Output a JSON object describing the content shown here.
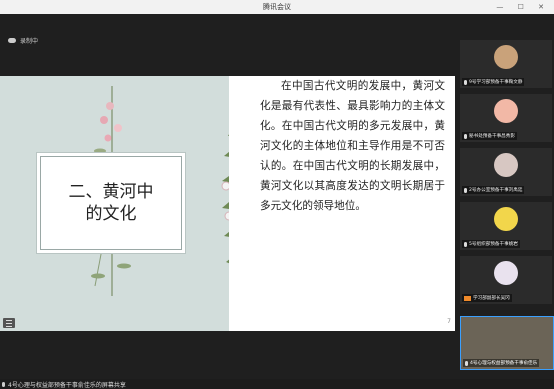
{
  "window": {
    "title": "腾讯会议"
  },
  "recording": {
    "label": "录制中"
  },
  "slide": {
    "title": "二、黄河中\n的文化",
    "body": "在中国古代文明的发展中，黄河文化是最有代表性、最具影响力的主体文化。在中国古代文明的多元发展中，黄河文化的主体地位和主导作用是不可否认的。在中国古代文明的长期发展中，黄河文化以其高度发达的文明长期居于多元文化的领导地位。",
    "page_number": "7"
  },
  "participants": [
    {
      "name": "9号学习部预备干事鞠文静",
      "avatar": "animal"
    },
    {
      "name": "秘书处预备干事昌秀影",
      "avatar": "pig"
    },
    {
      "name": "2号办公室预备干事刘禹廷",
      "avatar": "girl"
    },
    {
      "name": "5号组织部预备干事姚岩",
      "avatar": "cartoon"
    },
    {
      "name": "学习部副部长吴冈",
      "avatar": "anime"
    }
  ],
  "active_video": {
    "name": "4号心理与权益部预备干事俞佳乐"
  },
  "share_banner": {
    "text": "4号心理与权益部预备干事俞佳乐的屏幕共享"
  },
  "colors": {
    "slide_left_bg": "#d2dddb",
    "accent_blue": "#3ba0ff",
    "orange": "#f08a2a"
  }
}
